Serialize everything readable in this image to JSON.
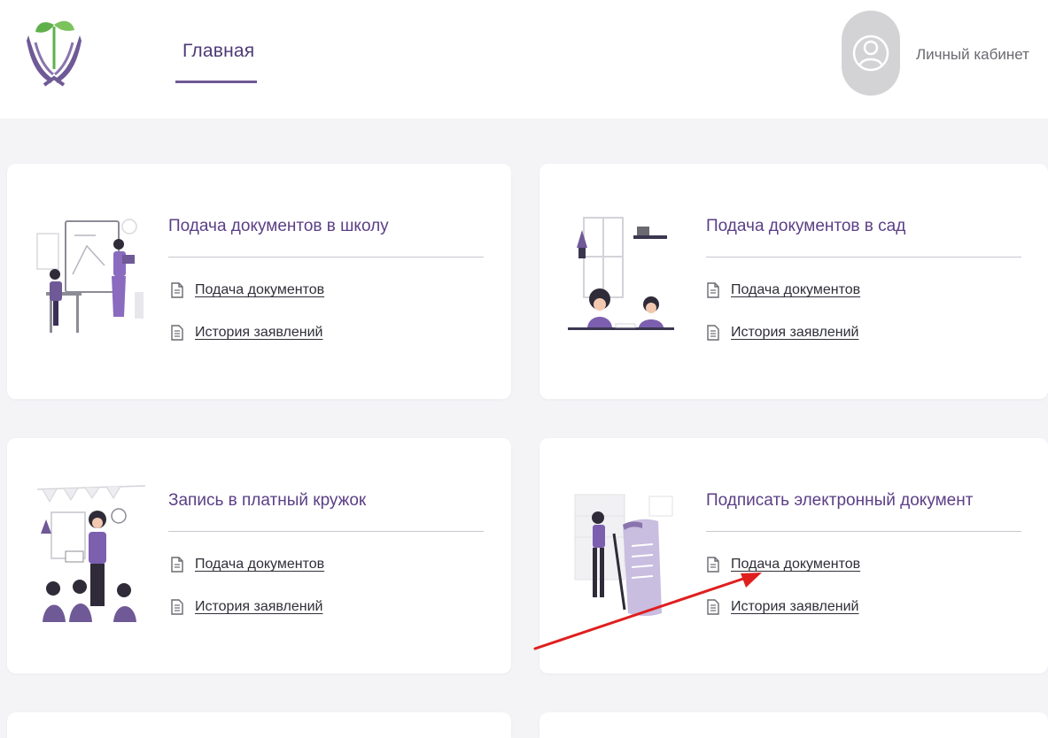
{
  "header": {
    "nav": {
      "home_label": "Главная"
    },
    "account_label": "Личный кабинет"
  },
  "colors": {
    "brand_purple": "#6f5996",
    "title_purple": "#5b3f86",
    "leaf_green": "#5fb04a",
    "page_bg": "#f4f3f6",
    "annotation_arrow": "#e01e1e"
  },
  "cards": [
    {
      "title": "Подача документов в школу",
      "link_submit": "Подача документов",
      "link_history": "История заявлений"
    },
    {
      "title": "Подача документов в сад",
      "link_submit": "Подача документов",
      "link_history": "История заявлений"
    },
    {
      "title": "Запись в платный кружок",
      "link_submit": "Подача документов",
      "link_history": "История заявлений"
    },
    {
      "title": "Подписать электронный документ",
      "link_submit": "Подача документов",
      "link_history": "История заявлений"
    }
  ]
}
